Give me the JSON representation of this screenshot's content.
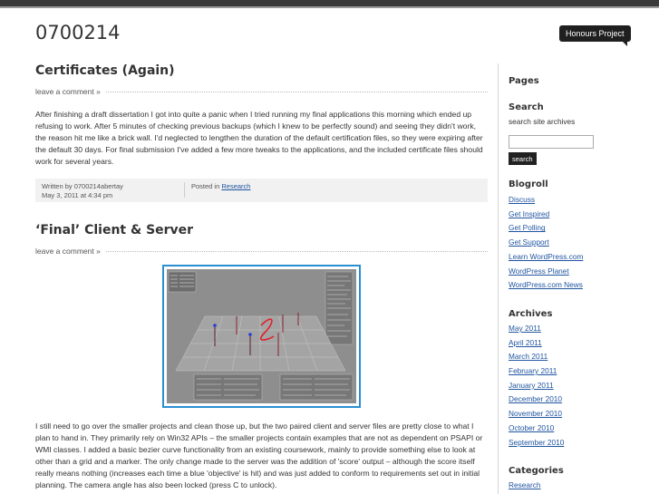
{
  "site": {
    "title": "0700214",
    "tagline": "Honours Project"
  },
  "posts": [
    {
      "title": "Certificates (Again)",
      "comment_link": "leave a comment »",
      "body": "After finishing a draft dissertation I got into quite a panic when I tried running my final applications this morning which ended up refusing to work. After 5 minutes of checking previous backups (which I knew to be perfectly sound) and seeing they didn't work, the reason hit me like a brick wall. I'd neglected to lengthen the duration of the default certification files, so they were expiring after the default 30 days. For final submission I've added a few more tweaks to the applications, and the included certificate files should work for several years.",
      "written_by": "Written by 0700214abertay",
      "date": "May 3, 2011 at 4:34 pm",
      "posted_in_label": "Posted in",
      "category": "Research"
    },
    {
      "title": "‘Final’ Client & Server",
      "comment_link": "leave a comment »",
      "body": "I still need to go over the smaller projects and clean those up, but the two paired client and server files are pretty close to what I plan to hand in. They primarily rely on Win32 APIs – the smaller projects contain examples that are not as dependent on PSAPI or WMI classes. I added a basic bezier curve functionality from an existing coursework, mainly to provide something else to look at other than a grid and a marker. The only change made to the server was the addition of 'score' output – although the score itself really means nothing (increases each time a blue 'objective' is hit) and was just added to conform to requirements set out in initial planning. The camera angle has also been locked (press C to unlock)."
    }
  ],
  "sidebar": {
    "pages_title": "Pages",
    "search": {
      "title": "Search",
      "desc": "search site archives",
      "button": "search"
    },
    "blogroll": {
      "title": "Blogroll",
      "links": [
        "Discuss",
        "Get Inspired",
        "Get Polling",
        "Get Support",
        "Learn WordPress.com",
        "WordPress Planet",
        "WordPress.com News"
      ]
    },
    "archives": {
      "title": "Archives",
      "links": [
        "May 2011",
        "April 2011",
        "March 2011",
        "February 2011",
        "January 2011",
        "December 2010",
        "November 2010",
        "October 2010",
        "September 2010"
      ]
    },
    "categories": {
      "title": "Categories",
      "links": [
        "Research"
      ]
    }
  },
  "colors": {
    "link": "#2155a0",
    "figure_border": "#2a8fd0",
    "topbar": "#3a3a3a"
  }
}
